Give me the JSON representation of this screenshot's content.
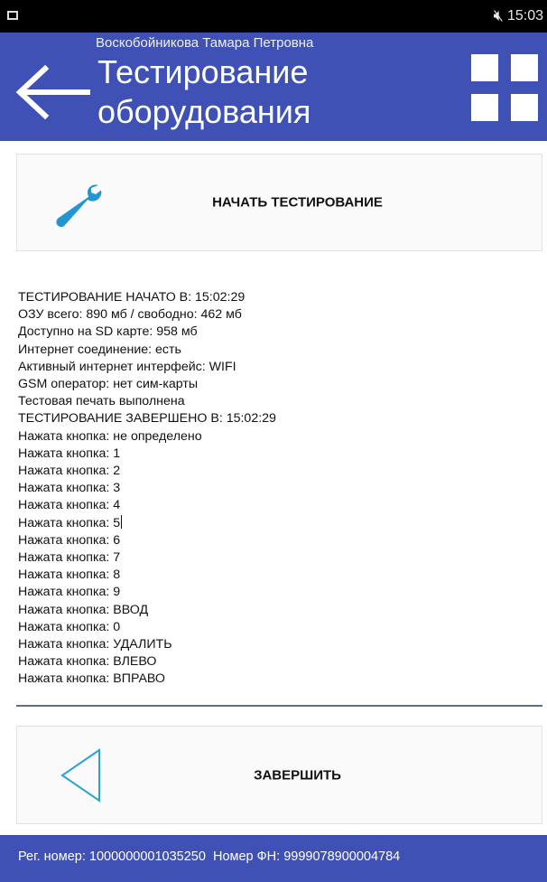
{
  "status_bar": {
    "time": "15:03",
    "icons": [
      "image-icon",
      "mute-icon",
      "no-sim-icon",
      "wifi-icon",
      "block-icon"
    ]
  },
  "header": {
    "user_name": "Воскобойникова Тамара Петровна",
    "title": "Тестирование оборудования"
  },
  "start_card": {
    "label": "НАЧАТЬ ТЕСТИРОВАНИЕ",
    "icon": "wrench-icon",
    "icon_color": "#2196d3"
  },
  "log_lines": [
    "ТЕСТИРОВАНИЕ НАЧАТО В: 15:02:29",
    "ОЗУ всего: 890 мб / свободно: 462 мб",
    "Доступно на SD карте: 958 мб",
    "Интернет соединение: есть",
    "Активный интернет интерфейс: WIFI",
    "GSM оператор: нет сим-карты",
    "Тестовая печать выполнена",
    "ТЕСТИРОВАНИЕ ЗАВЕРШЕНО В: 15:02:29",
    "Нажата кнопка: не определено",
    "Нажата кнопка: 1",
    "Нажата кнопка: 2",
    "Нажата кнопка: 3",
    "Нажата кнопка: 4",
    "Нажата кнопка: 5",
    "Нажата кнопка: 6",
    "Нажата кнопка: 7",
    "Нажата кнопка: 8",
    "Нажата кнопка: 9",
    "Нажата кнопка: ВВОД",
    "Нажата кнопка: 0",
    "Нажата кнопка: УДАЛИТЬ",
    "Нажата кнопка: ВЛЕВО",
    "Нажата кнопка: ВПРАВО"
  ],
  "finish_card": {
    "label": "ЗАВЕРШИТЬ",
    "icon": "back-triangle-icon",
    "icon_color": "#2ba3d4"
  },
  "footer": {
    "text": "Рег. номер: 1000000001035250  Номер ФН: 9999078900004784"
  },
  "colors": {
    "primary": "#3f51b5",
    "accent": "#2196d3"
  }
}
